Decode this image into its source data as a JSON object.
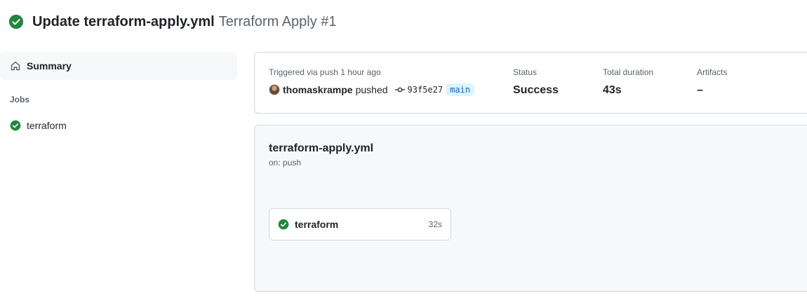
{
  "header": {
    "status_icon": "check-circle-fill-icon",
    "title": "Update terraform-apply.yml",
    "subtitle": "Terraform Apply #1"
  },
  "sidebar": {
    "summary": {
      "icon": "home-icon",
      "label": "Summary"
    },
    "jobs_heading": "Jobs",
    "jobs": [
      {
        "icon": "check-circle-fill-icon",
        "label": "terraform"
      }
    ]
  },
  "summary_card": {
    "trigger_label": "Triggered via push 1 hour ago",
    "author": "thomaskrampe",
    "pushed_text": "pushed",
    "commit_icon": "git-commit-icon",
    "commit_sha": "93f5e27",
    "branch": "main",
    "status_label": "Status",
    "status_value": "Success",
    "duration_label": "Total duration",
    "duration_value": "43s",
    "artifacts_label": "Artifacts",
    "artifacts_value": "–"
  },
  "workflow": {
    "name": "terraform-apply.yml",
    "trigger": "on: push",
    "jobs": [
      {
        "icon": "check-circle-fill-icon",
        "name": "terraform",
        "duration": "32s"
      }
    ]
  },
  "colors": {
    "success": "#1f883d",
    "branch_text": "#0969da",
    "branch_bg": "#ddf4ff",
    "muted_text": "#59636e",
    "border": "#d1d9e0",
    "subtle_bg": "#f6f8fa"
  }
}
